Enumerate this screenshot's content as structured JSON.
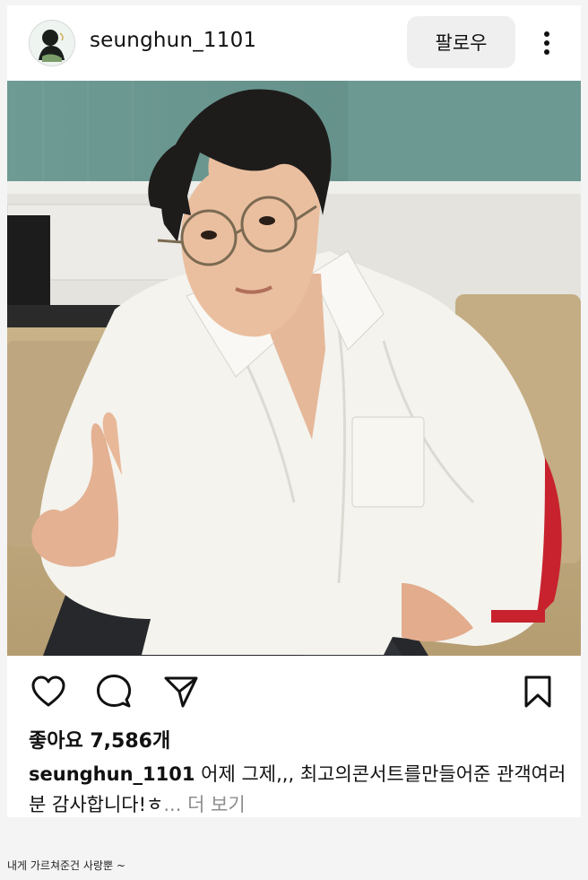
{
  "post": {
    "username": "seunghun_1101",
    "follow_label": "팔로우",
    "likes_text": "좋아요 7,586개",
    "caption_text": "어제 그제,,, 최고의콘서트를만들어준 관객여러분 감사합니다!ㅎ",
    "ellipsis": "...",
    "more_label": "더 보기"
  },
  "icons": {
    "more": "more-vertical-icon",
    "like": "heart-icon",
    "comment": "comment-bubble-icon",
    "share": "paper-plane-icon",
    "save": "bookmark-icon"
  },
  "footer": {
    "note": "내게 가르쳐준건 사랑뿐 ~"
  },
  "colors": {
    "card": "#ffffff",
    "page_bg": "#f4f4f4",
    "follow_bg": "#efefef",
    "muted": "#8e8e8e"
  }
}
